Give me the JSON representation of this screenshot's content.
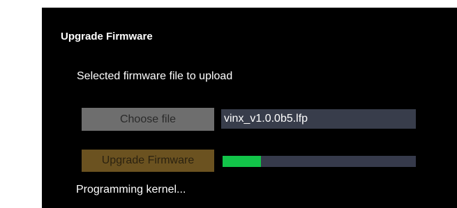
{
  "panel": {
    "title": "Upgrade Firmware",
    "subtitle": "Selected firmware file to upload"
  },
  "choose_button": {
    "label": "Choose file"
  },
  "file_field": {
    "value": "vinx_v1.0.0b5.lfp"
  },
  "upgrade_button": {
    "label": "Upgrade Firmware"
  },
  "progress": {
    "fraction": 0.2
  },
  "status": {
    "text": "Programming kernel..."
  },
  "colors": {
    "background": "#000000",
    "progress_fill": "#12c449",
    "progress_track": "#363a4b",
    "choose_button": "#6e6e6e",
    "upgrade_button": "#6b5220"
  }
}
